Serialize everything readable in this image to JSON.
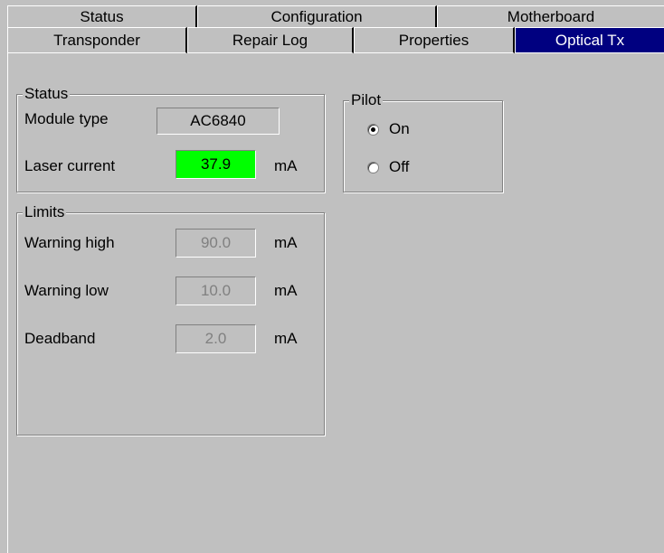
{
  "tabs": {
    "row1": [
      "Status",
      "Configuration",
      "Motherboard"
    ],
    "row2": [
      "Transponder",
      "Repair Log",
      "Properties",
      "Optical Tx"
    ],
    "active": "Optical Tx"
  },
  "status_group": {
    "legend": "Status",
    "module_type_label": "Module type",
    "module_type_value": "AC6840",
    "laser_current_label": "Laser current",
    "laser_current_value": "37.9",
    "laser_current_unit": "mA",
    "laser_current_bg": "#00ff00"
  },
  "pilot_group": {
    "legend": "Pilot",
    "on_label": "On",
    "off_label": "Off",
    "selected": "On"
  },
  "limits_group": {
    "legend": "Limits",
    "warning_high_label": "Warning high",
    "warning_high_value": "90.0",
    "warning_low_label": "Warning low",
    "warning_low_value": "10.0",
    "deadband_label": "Deadband",
    "deadband_value": "2.0",
    "unit": "mA"
  },
  "colors": {
    "background": "#c0c0c0",
    "active_tab": "#000080"
  }
}
